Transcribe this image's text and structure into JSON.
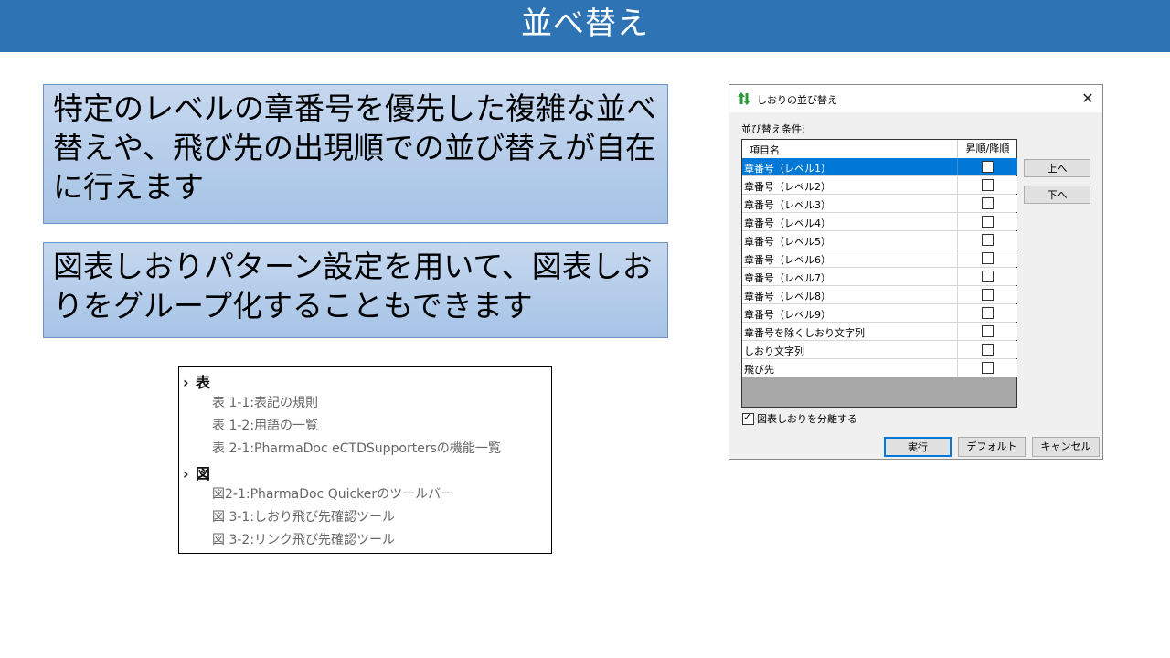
{
  "title": "並べ替え",
  "callouts": [
    "特定のレベルの章番号を優先した複雑な並べ替えや、飛び先の出現順での並び替えが自在に行えます",
    "図表しおりパターン設定を用いて、図表しおりをグループ化することもできます"
  ],
  "bookmarks": {
    "group1": {
      "label": "表",
      "items": [
        "表 1-1:表記の規則",
        "表 1-2:用語の一覧",
        "表 2-1:PharmaDoc eCTDSupportersの機能一覧"
      ]
    },
    "group2": {
      "label": "図",
      "items": [
        "図2-1:PharmaDoc Quickerのツールバー",
        "図 3-1:しおり飛び先確認ツール",
        "図 3-2:リンク飛び先確認ツール"
      ]
    }
  },
  "dialog": {
    "title": "しおりの並び替え",
    "close": "✕",
    "condition_label": "並び替え条件:",
    "col_name": "項目名",
    "col_sort": "昇順/降順",
    "rows": [
      "章番号（レベル1）",
      "章番号（レベル2）",
      "章番号（レベル3）",
      "章番号（レベル4）",
      "章番号（レベル5）",
      "章番号（レベル6）",
      "章番号（レベル7）",
      "章番号（レベル8）",
      "章番号（レベル9）",
      "章番号を除くしおり文字列",
      "しおり文字列",
      "飛び先"
    ],
    "selected_row": 0,
    "up": "上へ",
    "down": "下へ",
    "separate_label": "図表しおりを分離する",
    "separate_checked": true,
    "run": "実行",
    "default": "デフォルト",
    "cancel": "キャンセル"
  }
}
